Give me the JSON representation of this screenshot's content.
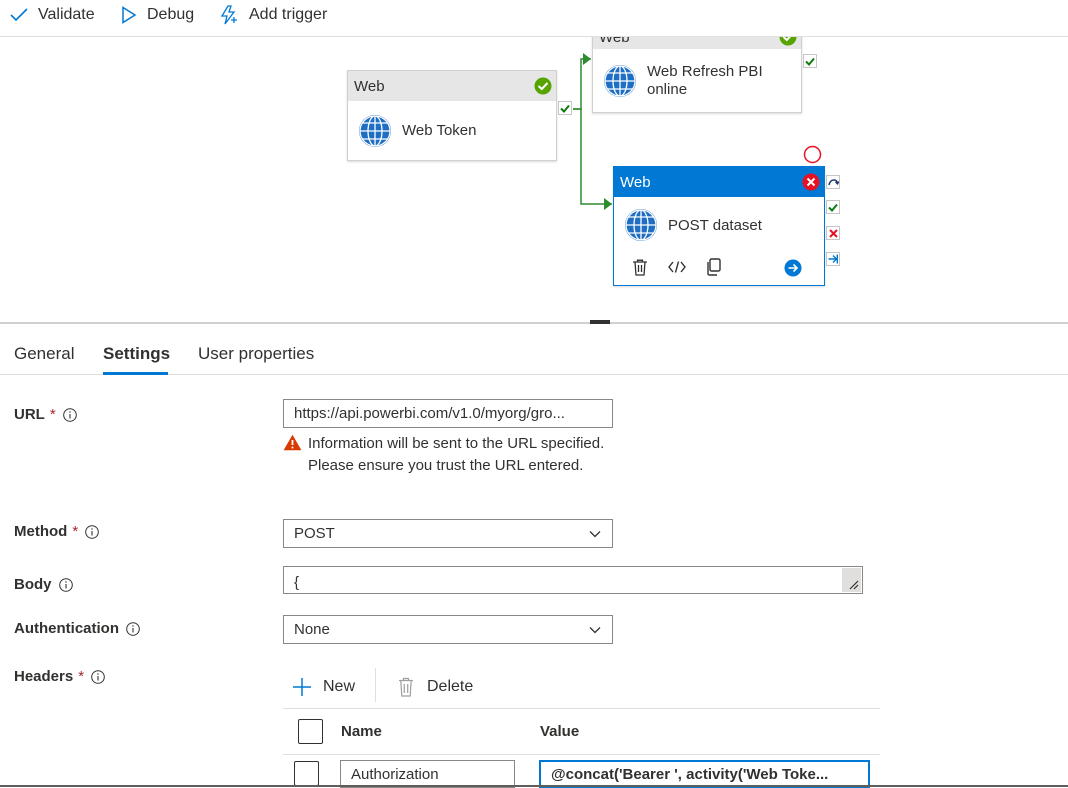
{
  "toolbar": {
    "validate_label": "Validate",
    "debug_label": "Debug",
    "add_trigger_label": "Add trigger"
  },
  "canvas": {
    "nodes": {
      "web_token": {
        "type": "Web",
        "name": "Web Token",
        "status": "succeeded"
      },
      "web_refresh": {
        "type": "Web",
        "name_line1": "Web Refresh PBI",
        "name_line2": "online",
        "status": "succeeded"
      },
      "post_dataset": {
        "type": "Web",
        "name": "POST dataset",
        "status": "error",
        "selected": true
      }
    },
    "colors": {
      "accent": "#0078d4",
      "success": "#57a300",
      "error": "#e81123",
      "link": "#2e8b2e"
    }
  },
  "tabs": [
    {
      "label": "General",
      "active": false
    },
    {
      "label": "Settings",
      "active": true
    },
    {
      "label": "User properties",
      "active": false
    }
  ],
  "form": {
    "url": {
      "label": "URL",
      "required": "*",
      "value": "https://api.powerbi.com/v1.0/myorg/gro...",
      "warning": "Information will be sent to the URL specified. Please ensure you trust the URL entered."
    },
    "method": {
      "label": "Method",
      "required": "*",
      "value": "POST"
    },
    "body": {
      "label": "Body",
      "value": "{"
    },
    "authentication": {
      "label": "Authentication",
      "value": "None"
    },
    "headers": {
      "label": "Headers",
      "required": "*",
      "new_label": "New",
      "delete_label": "Delete",
      "columns": {
        "name": "Name",
        "value": "Value"
      },
      "rows": [
        {
          "name": "Authorization",
          "value": "@concat('Bearer ', activity('Web Toke..."
        }
      ]
    }
  }
}
